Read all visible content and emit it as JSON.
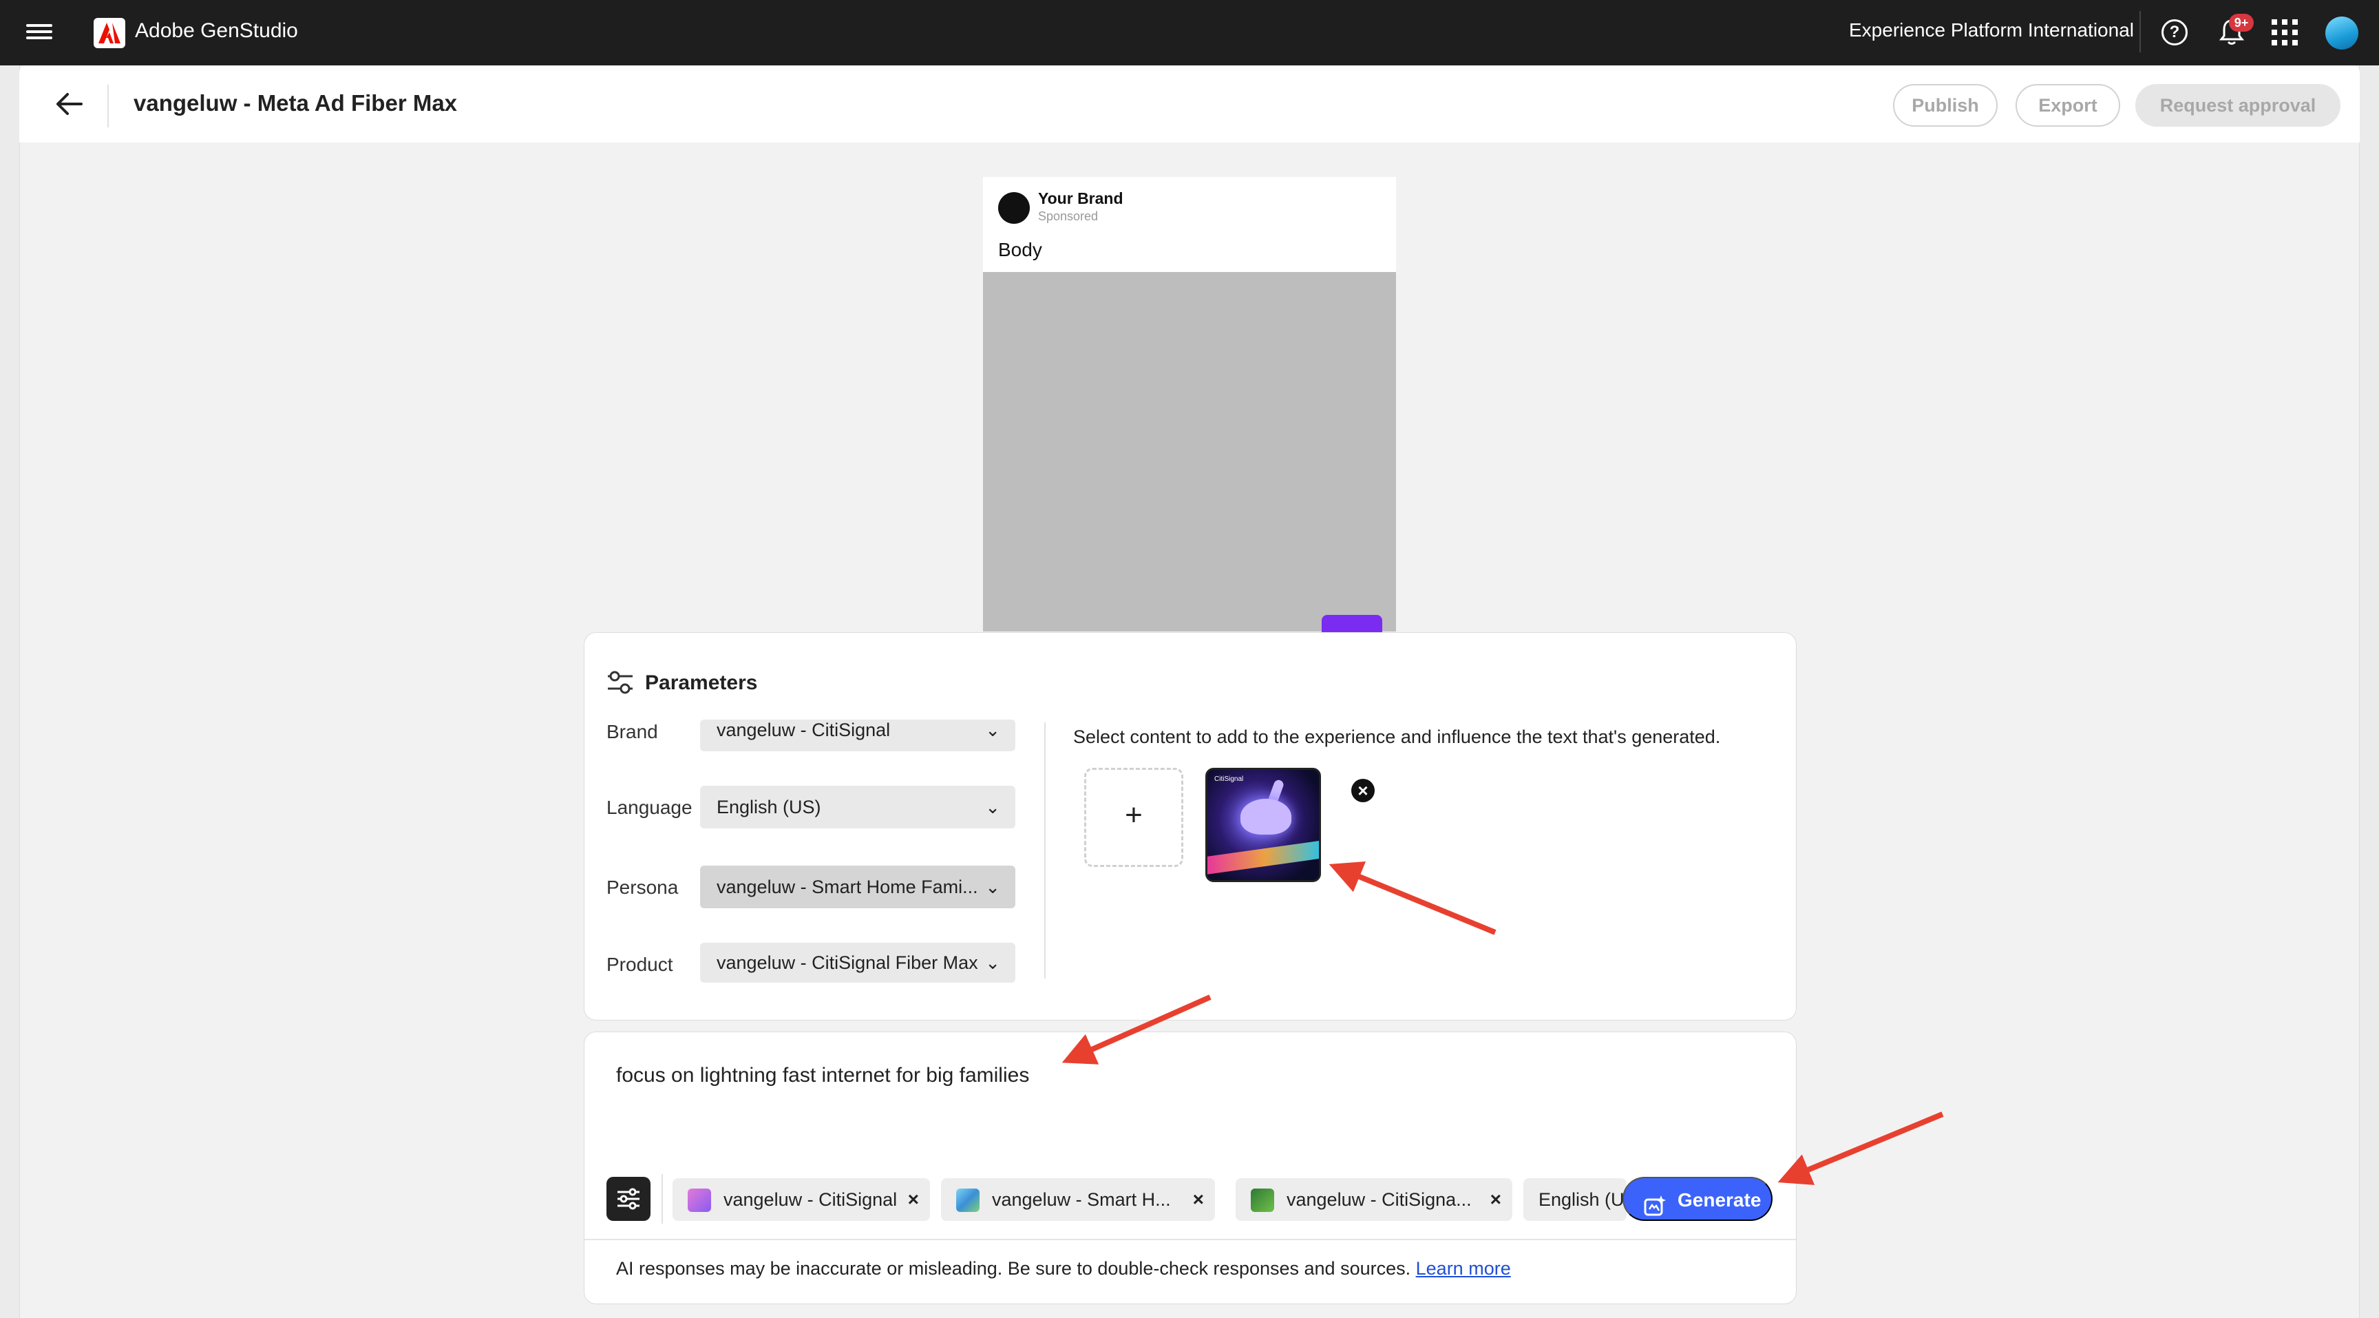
{
  "topbar": {
    "app_name": "Adobe GenStudio",
    "org_name": "Experience Platform International",
    "notification_count": "9+"
  },
  "header": {
    "title": "vangeluw - Meta Ad Fiber Max",
    "publish_label": "Publish",
    "export_label": "Export",
    "request_approval_label": "Request approval"
  },
  "ad_preview": {
    "brand_name": "Your Brand",
    "sponsored": "Sponsored",
    "body": "Body"
  },
  "parameters": {
    "title": "Parameters",
    "fields": [
      {
        "label": "Brand",
        "value": "vangeluw - CitiSignal"
      },
      {
        "label": "Language",
        "value": "English (US)"
      },
      {
        "label": "Persona",
        "value": "vangeluw - Smart Home Fami..."
      },
      {
        "label": "Product",
        "value": "vangeluw - CitiSignal Fiber Max"
      }
    ],
    "content_hint": "Select content to add to the experience and influence the text that's generated.",
    "add_symbol": "+",
    "thumbnail_caption": "CitiSignal"
  },
  "prompt": {
    "text": "focus on lightning fast internet for big families",
    "chips": [
      {
        "label": "vangeluw - CitiSignal",
        "color": "#b667e6"
      },
      {
        "label": "vangeluw - Smart H...",
        "color": "#5cb0e8"
      },
      {
        "label": "vangeluw - CitiSigna...",
        "color": "#3f8f3a"
      },
      {
        "label": "English (US"
      }
    ],
    "generate_label": "Generate",
    "disclaimer": "AI responses may be inaccurate or misleading. Be sure to double-check responses and sources.",
    "learn_more": "Learn more"
  },
  "colors": {
    "accent": "#3b63fb",
    "annotation_arrow": "#e8402f",
    "topbar": "#1e1e1e",
    "notification_badge": "#d7373f"
  }
}
